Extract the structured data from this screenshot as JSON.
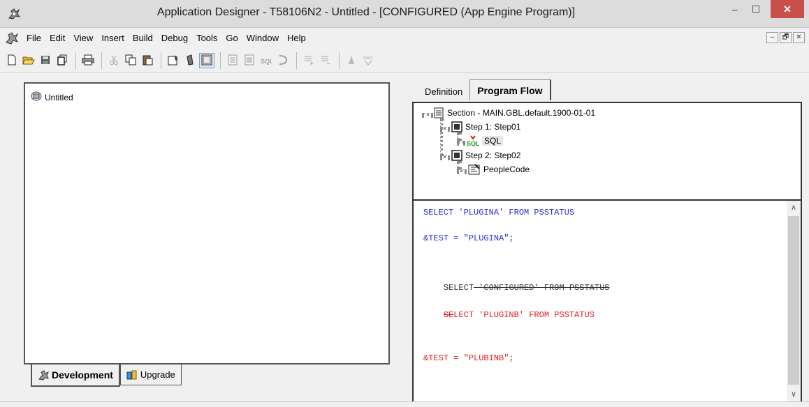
{
  "window": {
    "title": "Application Designer - T58106N2 - Untitled - [CONFIGURED (App Engine Program)]",
    "minimize": "–",
    "maximize": "☐",
    "close": "✕"
  },
  "menu": {
    "items": [
      "File",
      "Edit",
      "View",
      "Insert",
      "Build",
      "Debug",
      "Tools",
      "Go",
      "Window",
      "Help"
    ],
    "mdi_minimize": "–",
    "mdi_restore": "🗗",
    "mdi_close": "✕"
  },
  "left_panel": {
    "root_label": "Untitled",
    "tabs": [
      "Development",
      "Upgrade"
    ]
  },
  "right_panel": {
    "tabs": [
      "Definition",
      "Program Flow"
    ],
    "flow": {
      "section": "Section - MAIN.GBL.default.1900-01-01",
      "step1": "Step 1: Step01",
      "sql": "SQL",
      "step2": "Step 2: Step02",
      "peoplecode": "PeopleCode"
    },
    "code": {
      "line1": "SELECT 'PLUGINA' FROM PSSTATUS",
      "line2": "&TEST = \"PLUGINA\";",
      "line3_a": "SELECT",
      "line3_b": " 'CONFIGURED' FROM PSSTATUS",
      "line4_a": "SE",
      "line4_b": "LECT 'PLUGINB' FROM PSSTATUS",
      "line5": "&TEST = \"PLUBINB\";"
    }
  },
  "colors": {
    "code_blue": "#2b2bd9",
    "code_red": "#e01c1c",
    "close_button": "#c7504c"
  }
}
